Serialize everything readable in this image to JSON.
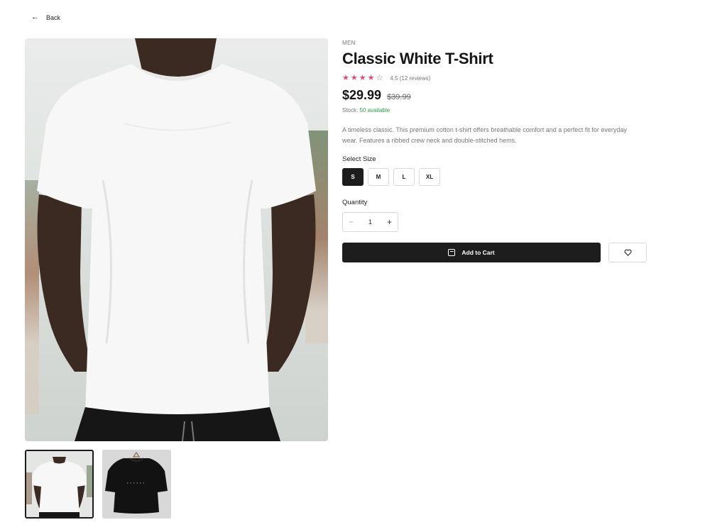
{
  "nav": {
    "back_label": "Back",
    "back_icon": "arrow-left-icon"
  },
  "product": {
    "category": "MEN",
    "title": "Classic White T-Shirt",
    "rating": 4.5,
    "rating_text": "4.5 (12 reviews)",
    "price": "$29.99",
    "old_price": "$39.99",
    "stock_label": "Stock:",
    "stock_value": "50 available",
    "description": "A timeless classic. This premium cotton t-shirt offers breathable comfort and a perfect fit for everyday wear. Features a ribbed crew neck and double-stitched hems."
  },
  "size": {
    "label": "Select Size",
    "options": [
      "S",
      "M",
      "L",
      "XL"
    ],
    "selected": "S"
  },
  "quantity": {
    "label": "Quantity",
    "value": "1",
    "minus": "−",
    "plus": "+"
  },
  "actions": {
    "add_to_cart": "Add to Cart",
    "cart_icon": "shopping-bag-icon",
    "wishlist_icon": "heart-icon"
  },
  "gallery": {
    "images": [
      "white t-shirt on model",
      "black t-shirt on hanger"
    ],
    "active_index": 0
  },
  "colors": {
    "accent_star": "#d94f7c",
    "stock_green": "#2e9a4a",
    "primary_button": "#1d1d1d"
  }
}
